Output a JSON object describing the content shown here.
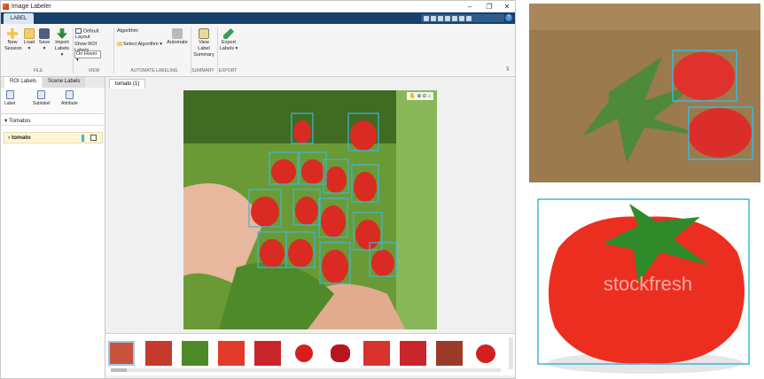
{
  "window": {
    "title": "Image Labeler"
  },
  "tabs": {
    "label_tab": "LABEL"
  },
  "ribbon": {
    "new_session": [
      "New",
      "Session"
    ],
    "load": [
      "Load",
      "▾"
    ],
    "save": [
      "Save",
      "▾"
    ],
    "import_labels": [
      "Import",
      "Labels ▾"
    ],
    "default_layout": "Default Layout",
    "show_roi_labels": "Show ROI Labels",
    "on_hover": "On Hover ▾",
    "algorithm": "Algorithm:",
    "select_algorithm": "Select Algorithm ▾",
    "automate": "Automate",
    "view_label_summary": [
      "View Label",
      "Summary"
    ],
    "export_labels": [
      "Export",
      "Labels ▾"
    ],
    "groups": [
      "FILE",
      "VIEW",
      "AUTOMATE LABELING",
      "SUMMARY",
      "EXPORT"
    ]
  },
  "left_panel": {
    "tabs": [
      "ROI Labels",
      "Scene Labels"
    ],
    "tools": [
      "Label",
      "Sublabel",
      "Attribute"
    ],
    "group": "Tomatos",
    "label": "tomato"
  },
  "document": {
    "tab": "tomato (1)"
  },
  "icons": [
    "pan-icon",
    "zoom-in-icon",
    "zoom-out-icon",
    "home-icon"
  ],
  "colors": {
    "accent": "#17406b",
    "roi_box": "#3fb6d8",
    "selected_label": "#fdf6d8"
  },
  "overlay": {
    "watermark": "stockfresh"
  }
}
